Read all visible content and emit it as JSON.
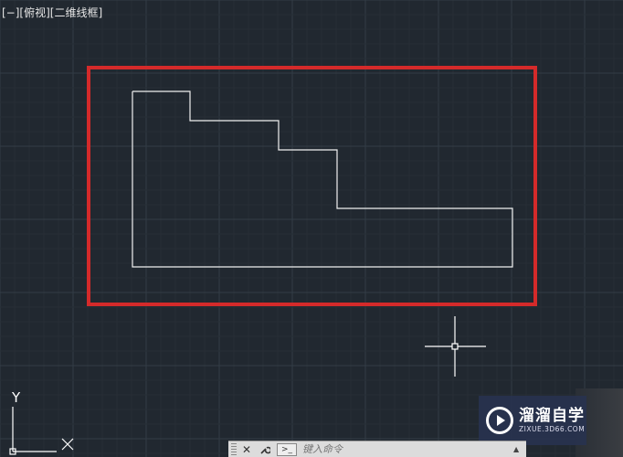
{
  "viewport": {
    "label_parts": [
      "[−]",
      "[俯视]",
      "[二维线框]"
    ]
  },
  "drawing": {
    "highlight_color": "#d42a2a",
    "line_color": "#f0f0f0",
    "grid_color": "#2c343d"
  },
  "ucs": {
    "y_label": "Y",
    "x_label": "X"
  },
  "command_line": {
    "close_icon": "close-icon",
    "settings_icon": "wrench-icon",
    "prompt_label": ">_",
    "placeholder": "键入命令"
  },
  "watermark": {
    "title": "溜溜自学",
    "url": "ZIXUE.3D66.COM"
  }
}
